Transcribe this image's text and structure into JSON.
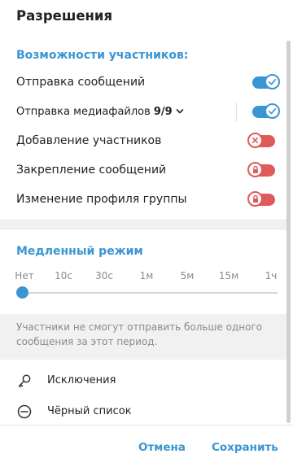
{
  "dialog": {
    "title": "Разрешения"
  },
  "permissions": {
    "section_title": "Возможности участников:",
    "items": [
      {
        "label": "Отправка сообщений",
        "state": "on"
      },
      {
        "label": "Отправка медиафайлов",
        "count": "9/9",
        "state": "on"
      },
      {
        "label": "Добавление участников",
        "state": "off",
        "icon": "x-icon"
      },
      {
        "label": "Закрепление сообщений",
        "state": "off",
        "icon": "lock-icon"
      },
      {
        "label": "Изменение профиля группы",
        "state": "off",
        "icon": "lock-icon"
      }
    ]
  },
  "slow_mode": {
    "title": "Медленный режим",
    "options": [
      "Нет",
      "10с",
      "30с",
      "1м",
      "5м",
      "15м",
      "1ч"
    ],
    "selected_index": 0,
    "info": "Участники не смогут отправить больше одного сообщения за этот период."
  },
  "links": {
    "exceptions": {
      "label": "Исключения",
      "icon": "key-icon"
    },
    "blacklist": {
      "label": "Чёрный список",
      "icon": "minus-circle-icon"
    }
  },
  "footer": {
    "cancel": "Отмена",
    "save": "Сохранить"
  },
  "colors": {
    "accent": "#3a95d3",
    "danger": "#e05a5a",
    "muted": "#8a8a8a"
  }
}
